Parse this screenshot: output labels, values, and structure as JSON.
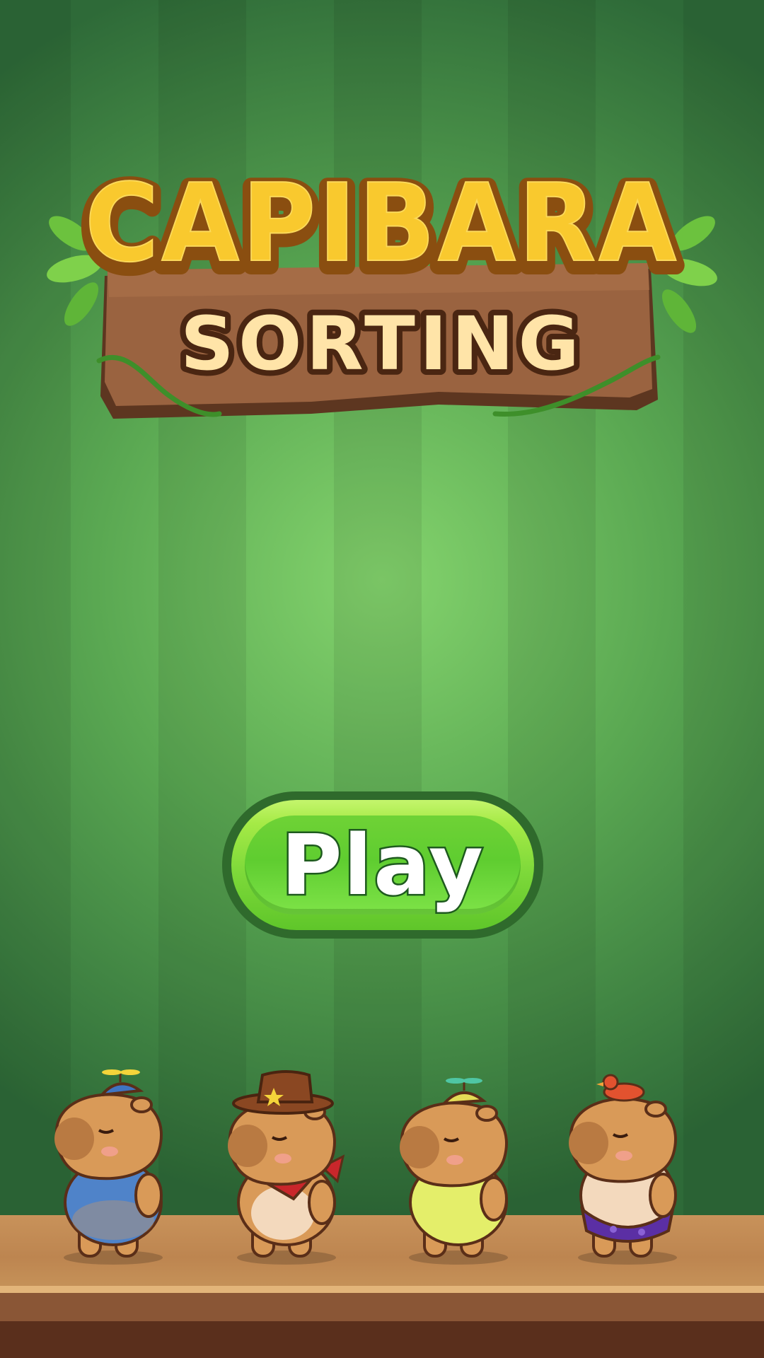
{
  "title": {
    "line1": "CAPIBARA",
    "line2": "SORTING"
  },
  "play_button": {
    "label": "Play"
  },
  "characters": [
    {
      "id": "capybara-blue-shirt",
      "hat": "propeller-cap",
      "outfit": "blue-shirt",
      "accent": "#4f83c9"
    },
    {
      "id": "capybara-cowboy",
      "hat": "cowboy-hat",
      "outfit": "red-bandana",
      "accent": "#c9262b"
    },
    {
      "id": "capybara-yellow-shirt",
      "hat": "propeller-cap",
      "outfit": "yellow-shirt",
      "accent": "#e4ee6a"
    },
    {
      "id": "capybara-duck-hat",
      "hat": "duck",
      "outfit": "purple-shorts",
      "accent": "#5b2fa4"
    }
  ],
  "colors": {
    "background": "#3f8a45",
    "background_light": "#7ed36a",
    "title_yellow": "#f7c62d",
    "sign_wood": "#8e5a35",
    "play_green": "#6fd236",
    "play_border": "#2f6a2c",
    "floor_wood": "#c8925a",
    "capybara_fur": "#d99a58"
  },
  "icons": {
    "leaf": "leaf-icon",
    "vine": "vine-icon"
  }
}
